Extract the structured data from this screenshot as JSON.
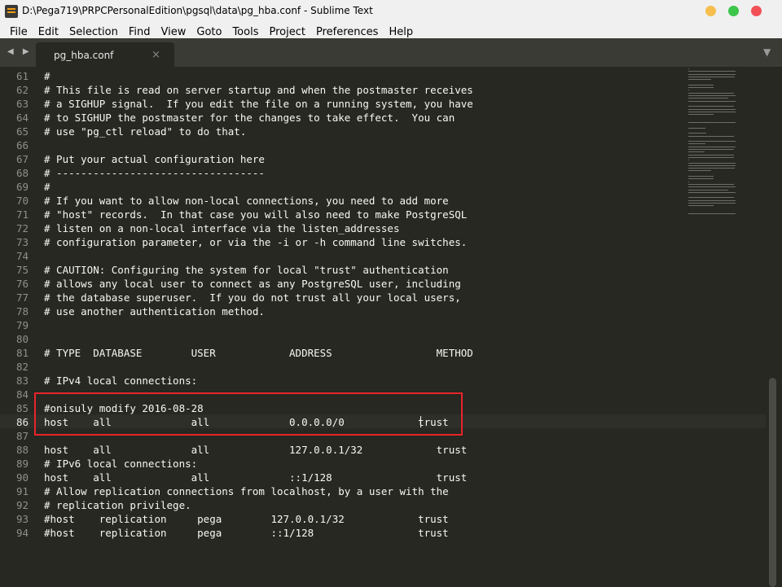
{
  "window": {
    "title": "D:\\Pega719\\PRPCPersonalEdition\\pgsql\\data\\pg_hba.conf - Sublime Text"
  },
  "menu": [
    "File",
    "Edit",
    "Selection",
    "Find",
    "View",
    "Goto",
    "Tools",
    "Project",
    "Preferences",
    "Help"
  ],
  "tab": {
    "label": "pg_hba.conf",
    "close": "×",
    "nav": "◀ ▶",
    "dropdown": "▼"
  },
  "editor": {
    "current_line": 86,
    "lines": [
      {
        "n": "61",
        "text": "#"
      },
      {
        "n": "62",
        "text": "# This file is read on server startup and when the postmaster receives"
      },
      {
        "n": "63",
        "text": "# a SIGHUP signal.  If you edit the file on a running system, you have"
      },
      {
        "n": "64",
        "text": "# to SIGHUP the postmaster for the changes to take effect.  You can"
      },
      {
        "n": "65",
        "text": "# use \"pg_ctl reload\" to do that."
      },
      {
        "n": "66",
        "text": ""
      },
      {
        "n": "67",
        "text": "# Put your actual configuration here"
      },
      {
        "n": "68",
        "text": "# ----------------------------------"
      },
      {
        "n": "69",
        "text": "#"
      },
      {
        "n": "70",
        "text": "# If you want to allow non-local connections, you need to add more"
      },
      {
        "n": "71",
        "text": "# \"host\" records.  In that case you will also need to make PostgreSQL"
      },
      {
        "n": "72",
        "text": "# listen on a non-local interface via the listen_addresses"
      },
      {
        "n": "73",
        "text": "# configuration parameter, or via the -i or -h command line switches."
      },
      {
        "n": "74",
        "text": ""
      },
      {
        "n": "75",
        "text": "# CAUTION: Configuring the system for local \"trust\" authentication"
      },
      {
        "n": "76",
        "text": "# allows any local user to connect as any PostgreSQL user, including"
      },
      {
        "n": "77",
        "text": "# the database superuser.  If you do not trust all your local users,"
      },
      {
        "n": "78",
        "text": "# use another authentication method."
      },
      {
        "n": "79",
        "text": ""
      },
      {
        "n": "80",
        "text": ""
      },
      {
        "n": "81",
        "text": "# TYPE  DATABASE        USER            ADDRESS                 METHOD"
      },
      {
        "n": "82",
        "text": ""
      },
      {
        "n": "83",
        "text": "# IPv4 local connections:"
      },
      {
        "n": "84",
        "text": ""
      },
      {
        "n": "85",
        "text": "#onisuly modify 2016-08-28"
      },
      {
        "n": "86",
        "text": "host    all             all             0.0.0.0/0            trust"
      },
      {
        "n": "87",
        "text": ""
      },
      {
        "n": "88",
        "text": "host    all             all             127.0.0.1/32            trust"
      },
      {
        "n": "89",
        "text": "# IPv6 local connections:"
      },
      {
        "n": "90",
        "text": "host    all             all             ::1/128                 trust"
      },
      {
        "n": "91",
        "text": "# Allow replication connections from localhost, by a user with the"
      },
      {
        "n": "92",
        "text": "# replication privilege."
      },
      {
        "n": "93",
        "text": "#host    replication     pega        127.0.0.1/32            trust"
      },
      {
        "n": "94",
        "text": "#host    replication     pega        ::1/128                 trust"
      }
    ]
  },
  "colors": {
    "background": "#272822",
    "foreground": "#f8f8f2",
    "gutter": "#8f908a",
    "highlight_box": "#e8242a"
  }
}
